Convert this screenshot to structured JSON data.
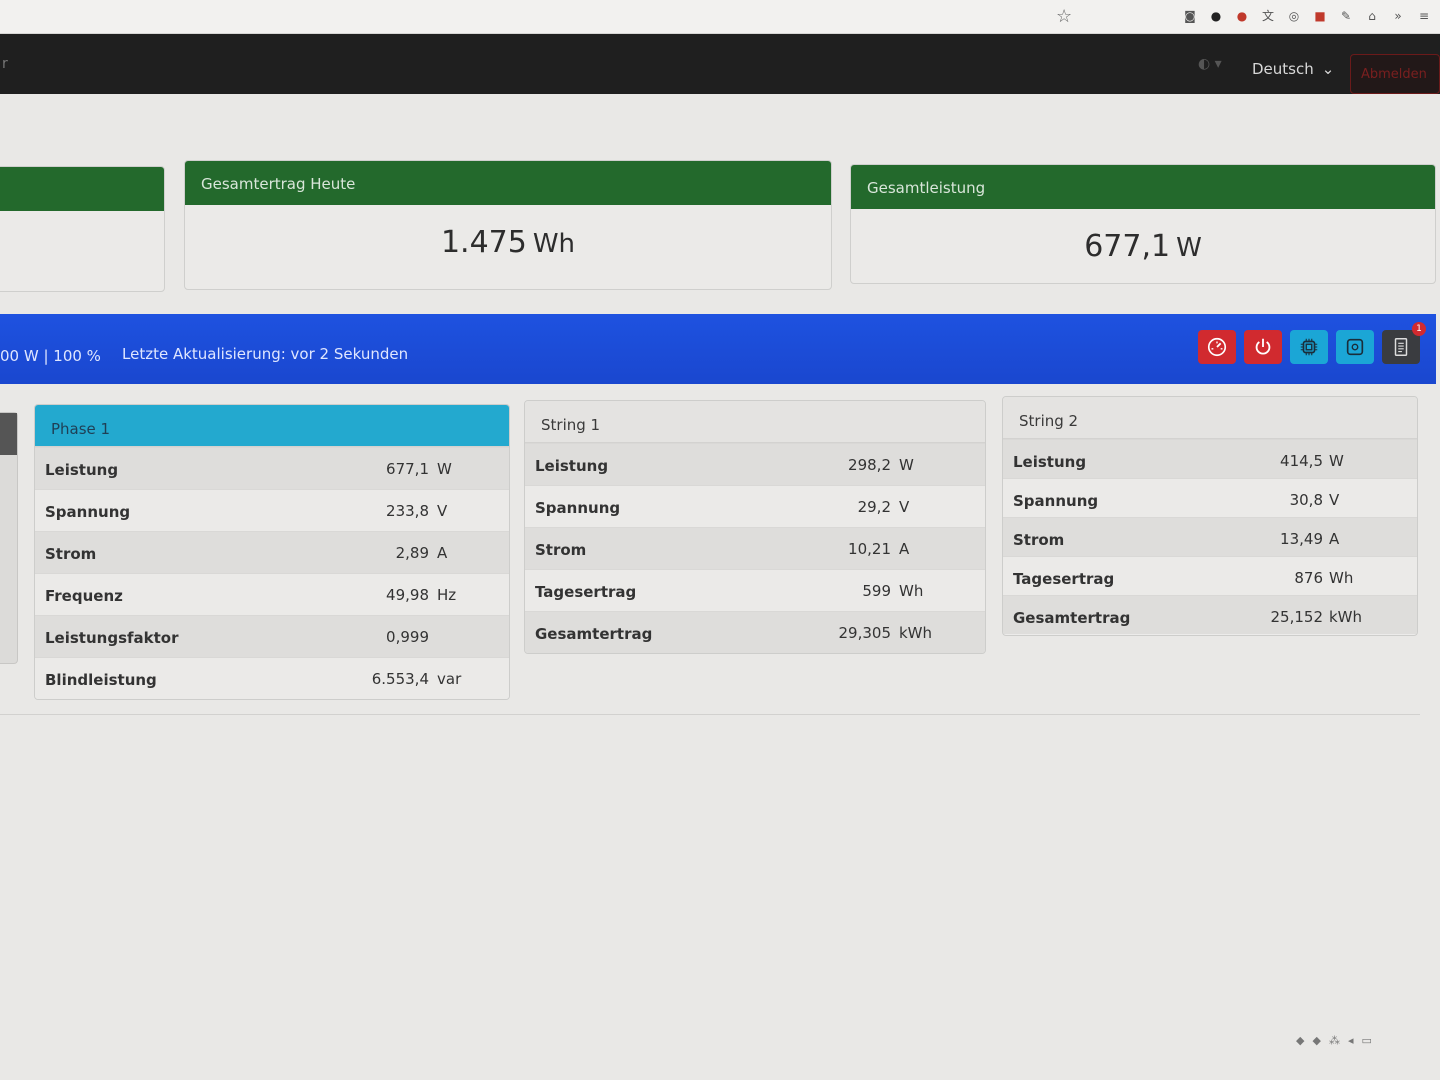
{
  "browser": {
    "icons": [
      "bookmark-star-icon",
      "pocket-icon",
      "extension-icon",
      "red-extension-icon",
      "translate-icon",
      "sync-icon",
      "pdf-icon",
      "puzzle-icon",
      "home-icon",
      "overflow-icon",
      "menu-icon"
    ]
  },
  "navbar": {
    "language": "Deutsch",
    "logout": "Abmelden"
  },
  "summary": {
    "total_today_title": "Gesamtertrag Heute",
    "total_today_value": "1.475",
    "total_today_unit": "Wh",
    "total_power_title": "Gesamtleistung",
    "total_power_value": "677,1",
    "total_power_unit": "W"
  },
  "status": {
    "power_limit": "00 W | 100 %",
    "last_update": "Letzte Aktualisierung: vor 2 Sekunden",
    "buttons": [
      "gauge-icon",
      "power-icon",
      "cpu-icon",
      "grid-icon",
      "log-icon"
    ],
    "badge": "1",
    "colors": {
      "bar": "#1d4ed8",
      "danger": "#d12a2f",
      "info": "#1ba6d6"
    }
  },
  "phase1": {
    "title": "Phase 1",
    "rows": [
      {
        "label": "Leistung",
        "value": "677,1",
        "unit": "W"
      },
      {
        "label": "Spannung",
        "value": "233,8",
        "unit": "V"
      },
      {
        "label": "Strom",
        "value": "2,89",
        "unit": "A"
      },
      {
        "label": "Frequenz",
        "value": "49,98",
        "unit": "Hz"
      },
      {
        "label": "Leistungsfaktor",
        "value": "0,999",
        "unit": ""
      },
      {
        "label": "Blindleistung",
        "value": "6.553,4",
        "unit": "var"
      }
    ]
  },
  "string1": {
    "title": "String 1",
    "rows": [
      {
        "label": "Leistung",
        "value": "298,2",
        "unit": "W"
      },
      {
        "label": "Spannung",
        "value": "29,2",
        "unit": "V"
      },
      {
        "label": "Strom",
        "value": "10,21",
        "unit": "A"
      },
      {
        "label": "Tagesertrag",
        "value": "599",
        "unit": "Wh"
      },
      {
        "label": "Gesamtertrag",
        "value": "29,305",
        "unit": "kWh"
      }
    ]
  },
  "string2": {
    "title": "String 2",
    "rows": [
      {
        "label": "Leistung",
        "value": "414,5",
        "unit": "W"
      },
      {
        "label": "Spannung",
        "value": "30,8",
        "unit": "V"
      },
      {
        "label": "Strom",
        "value": "13,49",
        "unit": "A"
      },
      {
        "label": "Tagesertrag",
        "value": "876",
        "unit": "Wh"
      },
      {
        "label": "Gesamtertrag",
        "value": "25,152",
        "unit": "kWh"
      }
    ]
  }
}
